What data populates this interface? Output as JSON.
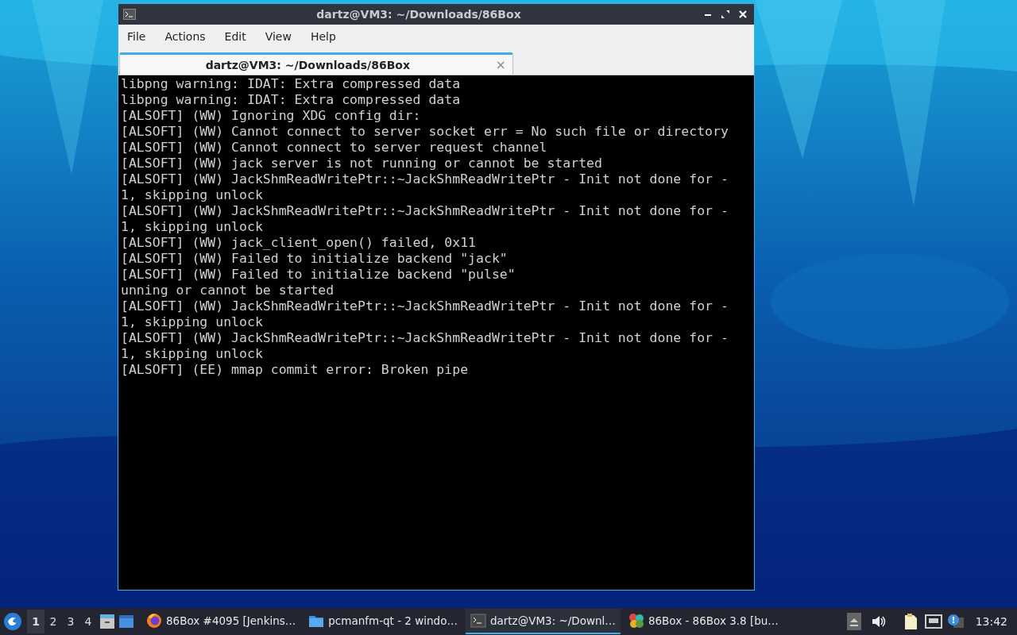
{
  "window": {
    "title": "dartz@VM3: ~/Downloads/86Box"
  },
  "menu": [
    "File",
    "Actions",
    "Edit",
    "View",
    "Help"
  ],
  "tabs": [
    {
      "label": "dartz@VM3: ~/Downloads/86Box",
      "selected": true,
      "close": "×"
    }
  ],
  "terminal": {
    "lines": [
      "libpng warning: IDAT: Extra compressed data",
      "libpng warning: IDAT: Extra compressed data",
      "[ALSOFT] (WW) Ignoring XDG config dir:",
      "[ALSOFT] (WW) Cannot connect to server socket err = No such file or directory",
      "[ALSOFT] (WW) Cannot connect to server request channel",
      "[ALSOFT] (WW) jack server is not running or cannot be started",
      "[ALSOFT] (WW) JackShmReadWritePtr::~JackShmReadWritePtr - Init not done for -",
      "1, skipping unlock",
      "[ALSOFT] (WW) JackShmReadWritePtr::~JackShmReadWritePtr - Init not done for -",
      "1, skipping unlock",
      "[ALSOFT] (WW) jack_client_open() failed, 0x11",
      "[ALSOFT] (WW) Failed to initialize backend \"jack\"",
      "[ALSOFT] (WW) Failed to initialize backend \"pulse\"",
      "unning or cannot be started",
      "[ALSOFT] (WW) JackShmReadWritePtr::~JackShmReadWritePtr - Init not done for -",
      "1, skipping unlock",
      "[ALSOFT] (WW) JackShmReadWritePtr::~JackShmReadWritePtr - Init not done for -",
      "1, skipping unlock",
      "[ALSOFT] (EE) mmap commit error: Broken pipe"
    ]
  },
  "taskbar": {
    "desktops": [
      {
        "label": "1",
        "selected": true
      },
      {
        "label": "2",
        "selected": false
      },
      {
        "label": "3",
        "selected": false
      },
      {
        "label": "4",
        "selected": false
      }
    ],
    "tasks": [
      {
        "kind": "browser",
        "label": "86Box #4095 [Jenkins…",
        "selected": false
      },
      {
        "kind": "folder",
        "label": "pcmanfm-qt - 2 windo…",
        "selected": false
      },
      {
        "kind": "terminal",
        "label": "dartz@VM3: ~/Downl…",
        "selected": true
      },
      {
        "kind": "app",
        "label": "86Box - 86Box 3.8 [bu…",
        "selected": false
      }
    ],
    "clock": "13:42"
  }
}
